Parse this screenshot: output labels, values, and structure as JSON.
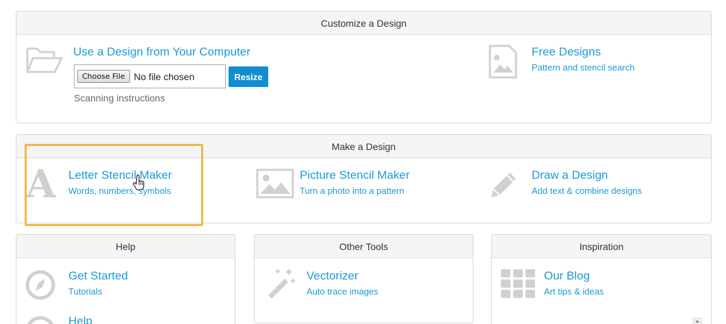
{
  "customize": {
    "title": "Customize a Design",
    "computer": {
      "title": "Use a Design from Your Computer",
      "choose_label": "Choose File",
      "file_status": "No file chosen",
      "resize_label": "Resize",
      "scanning": "Scanning instructions"
    },
    "free": {
      "title": "Free Designs",
      "subtitle": "Pattern and stencil search"
    }
  },
  "make": {
    "title": "Make a Design",
    "letter": {
      "title": "Letter Stencil Maker",
      "subtitle": "Words, numbers, symbols",
      "icon_glyph": "A"
    },
    "picture": {
      "title": "Picture Stencil Maker",
      "subtitle": "Turn a photo into a pattern"
    },
    "draw": {
      "title": "Draw a Design",
      "subtitle": "Add text & combine designs"
    }
  },
  "help": {
    "title": "Help",
    "get_started": {
      "title": "Get Started",
      "subtitle": "Tutorials"
    },
    "help_item": {
      "title": "Help"
    }
  },
  "tools": {
    "title": "Other Tools",
    "vectorizer": {
      "title": "Vectorizer",
      "subtitle": "Auto trace images"
    }
  },
  "inspiration": {
    "title": "Inspiration",
    "blog": {
      "title": "Our Blog",
      "subtitle": "Art tips & ideas"
    }
  },
  "colors": {
    "link": "#1a9ad6",
    "button": "#0f8fd2",
    "highlight": "#f5b53f",
    "icon": "#d0d0d0"
  }
}
